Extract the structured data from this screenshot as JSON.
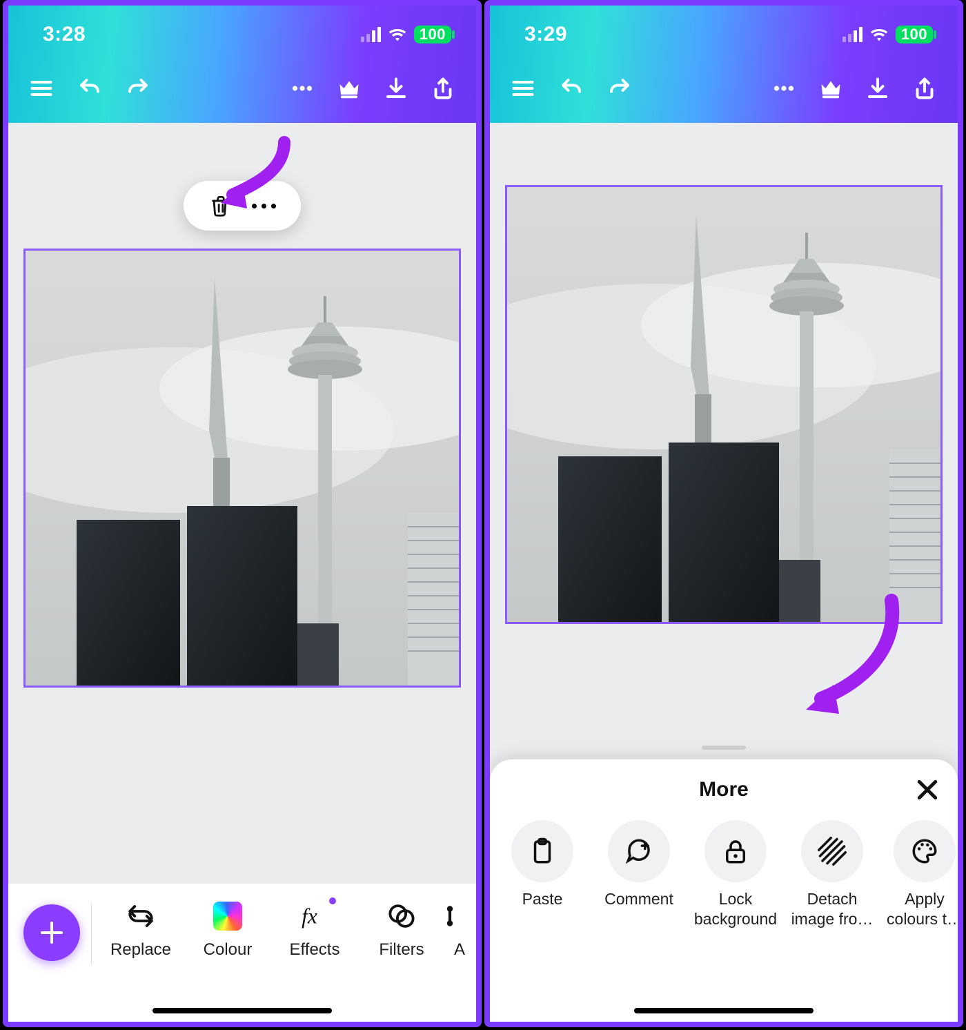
{
  "left": {
    "status": {
      "time": "3:28",
      "battery": "100"
    },
    "tools": [
      {
        "id": "replace",
        "label": "Replace"
      },
      {
        "id": "colour",
        "label": "Colour"
      },
      {
        "id": "effects",
        "label": "Effects"
      },
      {
        "id": "filters",
        "label": "Filters"
      },
      {
        "id": "adjust_cut",
        "label": "A"
      }
    ]
  },
  "right": {
    "status": {
      "time": "3:29",
      "battery": "100"
    },
    "sheet": {
      "title": "More",
      "items": [
        {
          "id": "paste",
          "label": "Paste"
        },
        {
          "id": "comment",
          "label": "Comment"
        },
        {
          "id": "lock_background",
          "label": "Lock\nbackground"
        },
        {
          "id": "detach_image",
          "label": "Detach\nimage fro…"
        },
        {
          "id": "apply_colours",
          "label": "Apply\ncolours t…"
        }
      ]
    }
  }
}
